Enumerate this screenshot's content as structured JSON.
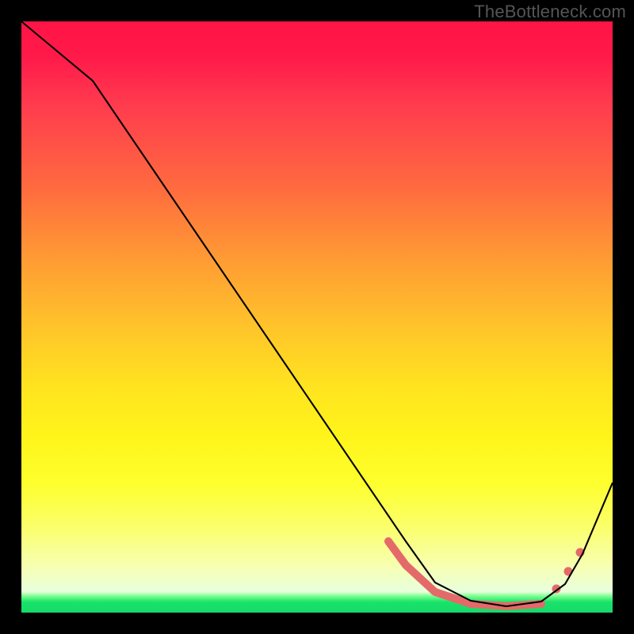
{
  "watermark": "TheBottleneck.com",
  "chart_data": {
    "type": "line",
    "title": "",
    "xlabel": "",
    "ylabel": "",
    "xlim": [
      0,
      100
    ],
    "ylim": [
      0,
      100
    ],
    "x": [
      0,
      12,
      65,
      70,
      76,
      82,
      88,
      92,
      95,
      100
    ],
    "values": [
      100,
      90,
      12,
      5,
      2,
      1,
      1,
      4,
      10,
      22
    ],
    "highlight_segment": {
      "x_start": 62,
      "x_end": 88
    },
    "highlight_dots_x": [
      90.5,
      92.5,
      94.5
    ],
    "colors": {
      "line": "#000000",
      "highlight": "#e46a6a",
      "gradient_top": "#ff1445",
      "gradient_bottom": "#17d968"
    }
  }
}
